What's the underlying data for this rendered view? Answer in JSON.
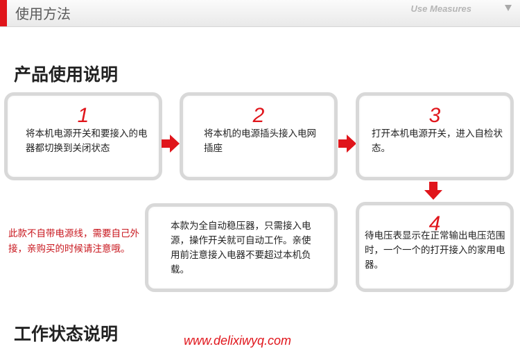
{
  "header": {
    "title": "使用方法",
    "subtitle": "Use Measures",
    "icon": "triangle-down-icon",
    "accent_color": "#e0151b"
  },
  "section1": {
    "title": "产品使用说明"
  },
  "steps": [
    {
      "number": "1",
      "text": "将本机电源开关和要接入的电器都切换到关闭状态"
    },
    {
      "number": "2",
      "text": "将本机的电源插头接入电网插座"
    },
    {
      "number": "3",
      "text": "打开本机电源开关，进入自检状态。"
    },
    {
      "number": "4",
      "text": "待电压表显示在正常输出电压范围时，一个一个的打开接入的家用电器。"
    }
  ],
  "info_box": {
    "text": "本款为全自动稳压器，只需接入电源，操作开关就可自动工作。亲使用前注意接入电器不要超过本机负载。"
  },
  "side_note": "此款不自带电源线，需要自己外接，亲购买的时候请注意哦。",
  "section2": {
    "title": "工作状态说明"
  },
  "watermark": "www.delixiwyq.com"
}
